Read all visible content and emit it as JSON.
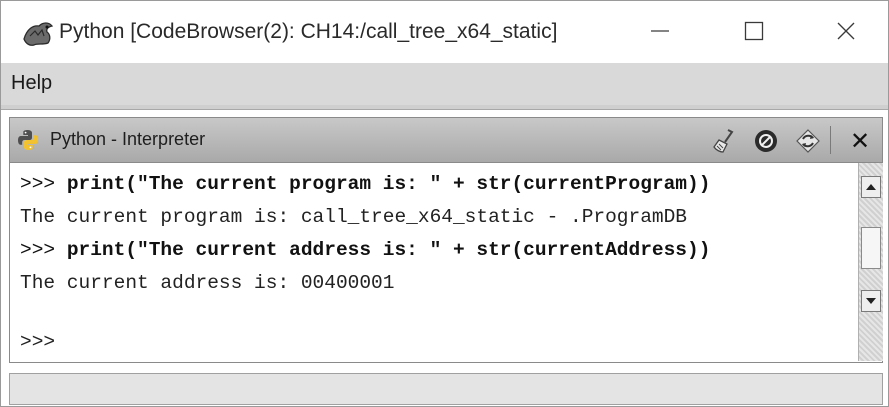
{
  "window": {
    "title": "Python [CodeBrowser(2): CH14:/call_tree_x64_static]",
    "app_icon": "dragon-icon",
    "controls": [
      "minimize-icon",
      "maximize-icon",
      "close-icon"
    ]
  },
  "menu": {
    "items": [
      {
        "label": "Help"
      }
    ]
  },
  "panel": {
    "title": "Python - Interpreter",
    "icon": "python-icon",
    "tools": [
      "clear-broom-icon",
      "stop-icon",
      "reset-icon",
      "close-icon"
    ]
  },
  "console": {
    "lines": [
      {
        "prompt": ">>> ",
        "text": "print(\"The current program is: \" + str(currentProgram))"
      },
      {
        "text": "The current program is: call_tree_x64_static - .ProgramDB"
      },
      {
        "prompt": ">>> ",
        "text": "print(\"The current address is: \" + str(currentAddress))"
      },
      {
        "text": "The current address is: 00400001"
      },
      {
        "prompt": ">>>"
      }
    ]
  },
  "colors": {
    "menu_bg": "#d9d9d9",
    "panel_header_bg": "#b5b5b5",
    "status_bg": "#e4e4e4"
  }
}
